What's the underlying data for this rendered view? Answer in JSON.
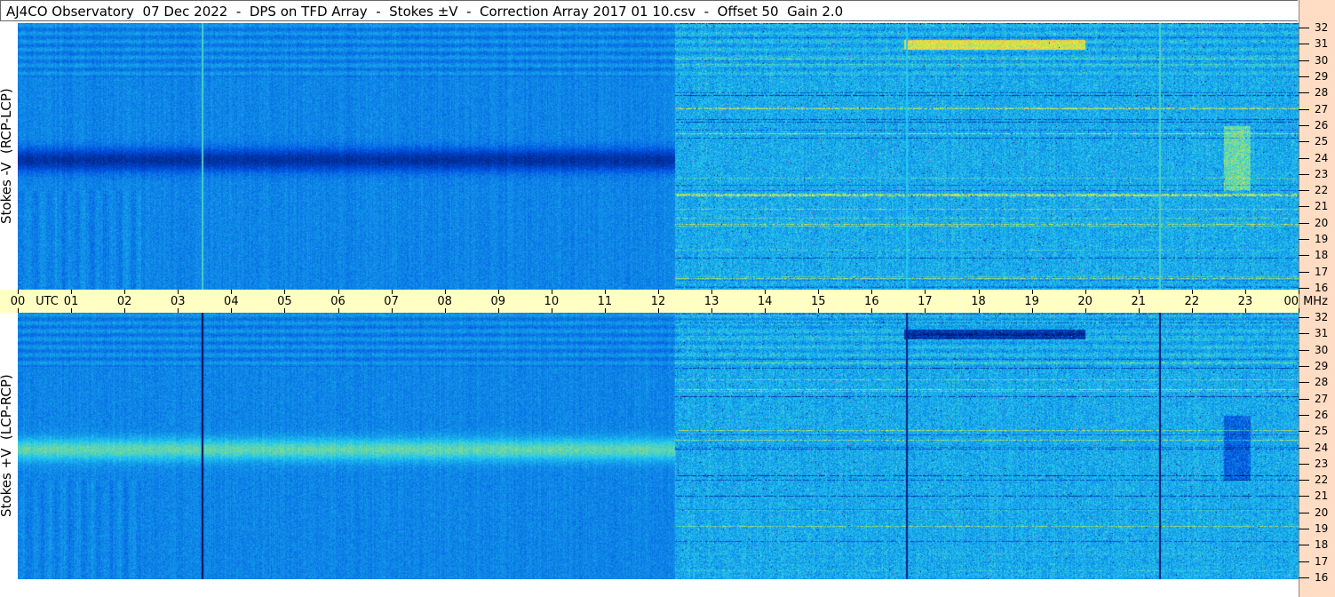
{
  "title": "AJ4CO Observatory  07 Dec 2022  -  DPS on TFD Array  -  Stokes ±V  -  Correction Array 2017 01 10.csv  -  Offset 50  Gain 2.0",
  "chart_data": {
    "type": "heatmap",
    "panels": [
      {
        "ylabel": "Stokes -V  (RCP-LCP)"
      },
      {
        "ylabel": "Stokes +V  (LCP-RCP)"
      }
    ],
    "x_ticks": [
      "00",
      "01",
      "02",
      "03",
      "04",
      "05",
      "06",
      "07",
      "08",
      "09",
      "10",
      "11",
      "12",
      "13",
      "14",
      "15",
      "16",
      "17",
      "18",
      "19",
      "20",
      "21",
      "22",
      "23",
      "00"
    ],
    "x_unit": "UTC",
    "y_unit": "MHz",
    "y_ticks": [
      16,
      17,
      18,
      19,
      20,
      21,
      22,
      23,
      24,
      25,
      26,
      27,
      28,
      29,
      30,
      31,
      32
    ],
    "xlim_hours": [
      0,
      24
    ],
    "ylim_mhz": [
      16,
      32
    ],
    "colormap": [
      "#000a50",
      "#0050e0",
      "#20c8f0",
      "#f0f020",
      "#ff40ff"
    ]
  }
}
